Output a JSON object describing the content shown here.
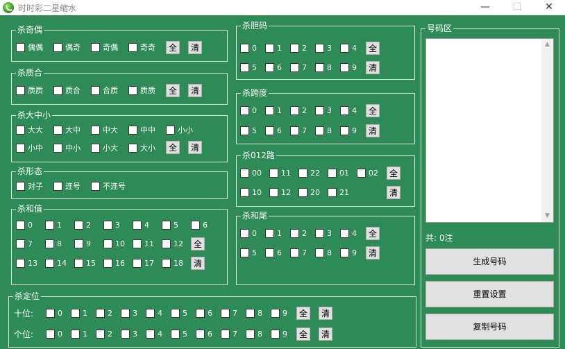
{
  "window": {
    "title": "时时彩二星缩水",
    "min": "—",
    "max": "☐",
    "close": "✕"
  },
  "btn": {
    "all": "全",
    "clear": "清"
  },
  "odd_even": {
    "label": "杀奇偶",
    "items": [
      "偶偶",
      "偶奇",
      "奇偶",
      "奇奇"
    ]
  },
  "prime": {
    "label": "杀质合",
    "items": [
      "质质",
      "质合",
      "合质",
      "质质"
    ]
  },
  "size": {
    "label": "杀大中小",
    "row1": [
      "大大",
      "大中",
      "中大",
      "中中",
      "小小"
    ],
    "row2": [
      "小中",
      "中小",
      "小大",
      "大小"
    ]
  },
  "shape": {
    "label": "杀形态",
    "items": [
      "对子",
      "连号",
      "不连号"
    ]
  },
  "sum": {
    "label": "杀和值",
    "row1": [
      "0",
      "1",
      "2",
      "3",
      "4",
      "5",
      "6"
    ],
    "row2": [
      "7",
      "8",
      "9",
      "10",
      "11",
      "12"
    ],
    "row3": [
      "13",
      "14",
      "15",
      "16",
      "17",
      "18"
    ]
  },
  "position": {
    "label": "杀定位",
    "tens_label": "十位:",
    "units_label": "个位:",
    "digits": [
      "0",
      "1",
      "2",
      "3",
      "4",
      "5",
      "6",
      "7",
      "8",
      "9"
    ]
  },
  "bold": {
    "label": "杀胆码",
    "row1": [
      "0",
      "1",
      "2",
      "3",
      "4"
    ],
    "row2": [
      "5",
      "6",
      "7",
      "8",
      "9"
    ]
  },
  "span": {
    "label": "杀跨度",
    "row1": [
      "0",
      "1",
      "2",
      "3",
      "4"
    ],
    "row2": [
      "5",
      "6",
      "7",
      "8",
      "9"
    ]
  },
  "road": {
    "label": "杀012路",
    "row1": [
      "00",
      "11",
      "22",
      "01",
      "02"
    ],
    "row2": [
      "10",
      "12",
      "20",
      "21"
    ]
  },
  "tail": {
    "label": "杀和尾",
    "row1": [
      "0",
      "1",
      "2",
      "3",
      "4"
    ],
    "row2": [
      "5",
      "6",
      "7",
      "8",
      "9"
    ]
  },
  "numbers": {
    "label": "号码区",
    "value": "",
    "count_text": "共: 0注"
  },
  "actions": {
    "generate": "生成号码",
    "reset": "重置设置",
    "copy": "复制号码"
  },
  "colors": {
    "background": "#2e8b57",
    "button": "#e1e1e1"
  }
}
